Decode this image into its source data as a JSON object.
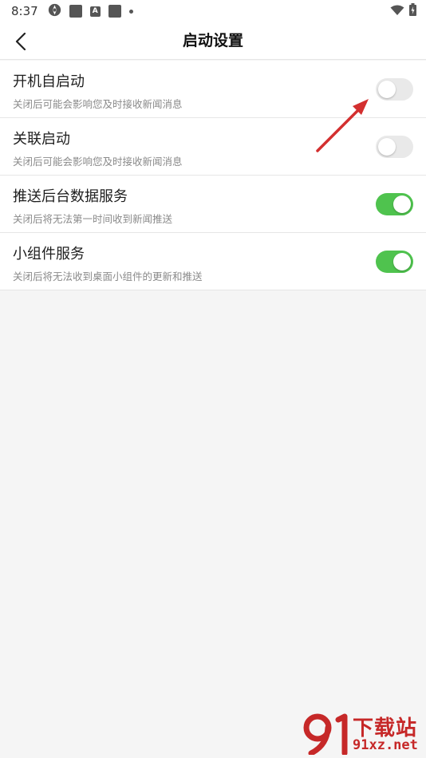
{
  "status_bar": {
    "time": "8:37",
    "icons": [
      "aperture-icon",
      "square-icon",
      "a-icon",
      "square-icon",
      "dot-icon",
      "wifi-icon",
      "battery-icon"
    ]
  },
  "header": {
    "title": "启动设置",
    "back_icon": "chevron-left-icon"
  },
  "settings": [
    {
      "title": "开机自启动",
      "description": "关闭后可能会影响您及时接收新闻消息",
      "enabled": false
    },
    {
      "title": "关联启动",
      "description": "关闭后可能会影响您及时接收新闻消息",
      "enabled": false
    },
    {
      "title": "推送后台数据服务",
      "description": "关闭后将无法第一时间收到新闻推送",
      "enabled": true
    },
    {
      "title": "小组件服务",
      "description": "关闭后将无法收到桌面小组件的更新和推送",
      "enabled": true
    }
  ],
  "colors": {
    "toggle_on": "#4fc34e",
    "toggle_off": "#e9e9e9",
    "annotation": "#d32f2f",
    "watermark": "#c62828"
  },
  "watermark": {
    "cn": "下载站",
    "url": "91xz.net"
  }
}
